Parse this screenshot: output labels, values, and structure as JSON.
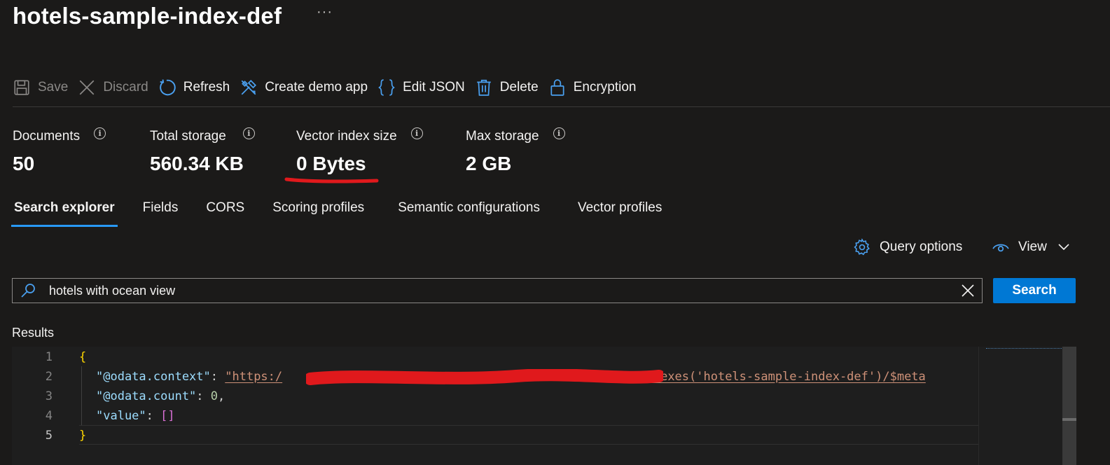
{
  "page": {
    "title": "hotels-sample-index-def",
    "more": "···"
  },
  "toolbar": {
    "save": "Save",
    "discard": "Discard",
    "refresh": "Refresh",
    "create_demo_app": "Create demo app",
    "edit_json": "Edit JSON",
    "delete": "Delete",
    "encryption": "Encryption"
  },
  "stats": {
    "documents": {
      "label": "Documents",
      "value": "50"
    },
    "total_storage": {
      "label": "Total storage",
      "value": "560.34 KB"
    },
    "vector_index_size": {
      "label": "Vector index size",
      "value": "0 Bytes"
    },
    "max_storage": {
      "label": "Max storage",
      "value": "2 GB"
    },
    "info_glyph": "i"
  },
  "tabs": [
    {
      "label": "Search explorer",
      "active": true
    },
    {
      "label": "Fields",
      "active": false
    },
    {
      "label": "CORS",
      "active": false
    },
    {
      "label": "Scoring profiles",
      "active": false
    },
    {
      "label": "Semantic configurations",
      "active": false
    },
    {
      "label": "Vector profiles",
      "active": false
    }
  ],
  "actions": {
    "query_options": "Query options",
    "view": "View"
  },
  "search": {
    "value": "hotels with ocean view",
    "button": "Search"
  },
  "results": {
    "label": "Results",
    "lines": [
      {
        "num": "1",
        "open_brace": "{"
      },
      {
        "num": "2",
        "key": "\"@odata.context\"",
        "colon": ": ",
        "value_prefix": "\"https:/",
        "value_suffix": "/indexes('hotels-sample-index-def')/$meta"
      },
      {
        "num": "3",
        "key": "\"@odata.count\"",
        "colon": ": ",
        "value": "0",
        "comma": ","
      },
      {
        "num": "4",
        "key": "\"value\"",
        "colon": ": ",
        "value": "[]"
      },
      {
        "num": "5",
        "close_brace": "}"
      }
    ]
  },
  "colors": {
    "accent": "#0078d4",
    "icon_blue": "#4aa0f0",
    "annotation_red": "#e0191c",
    "background": "#1b1a19"
  }
}
